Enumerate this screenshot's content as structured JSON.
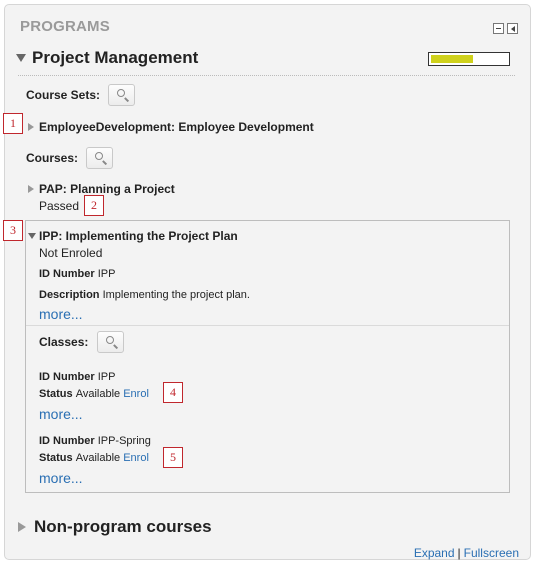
{
  "block": {
    "title": "PROGRAMS",
    "minimize_icon": "minus-icon",
    "dock_icon": "dock-icon"
  },
  "program": {
    "title": "Project Management",
    "progress_fraction": 0.55,
    "progress_color": "#cfd11b",
    "course_sets_label": "Course Sets:",
    "course_set": {
      "title": "EmployeeDevelopment: Employee Development"
    },
    "courses_label": "Courses:",
    "courses": [
      {
        "title": "PAP: Planning a Project",
        "status": "Passed"
      },
      {
        "title": "IPP: Implementing the Project Plan",
        "status": "Not Enroled",
        "id_label": "ID Number",
        "id_value": "IPP",
        "desc_label": "Description",
        "desc_value": "Implementing the project plan.",
        "more": "more...",
        "classes_label": "Classes:",
        "classes": [
          {
            "id_label": "ID Number",
            "id_value": "IPP",
            "status_label": "Status",
            "status_value": "Available",
            "enrol": "Enrol",
            "more": "more..."
          },
          {
            "id_label": "ID Number",
            "id_value": "IPP-Spring",
            "status_label": "Status",
            "status_value": "Available",
            "enrol": "Enrol",
            "more": "more..."
          }
        ]
      }
    ]
  },
  "non_program": {
    "title": "Non-program courses"
  },
  "footer": {
    "expand": "Expand",
    "separator": "|",
    "fullscreen": "Fullscreen"
  },
  "markers": [
    "1",
    "2",
    "3",
    "4",
    "5"
  ],
  "colors": {
    "link": "#2a6fb3",
    "marker": "#c0272d"
  }
}
